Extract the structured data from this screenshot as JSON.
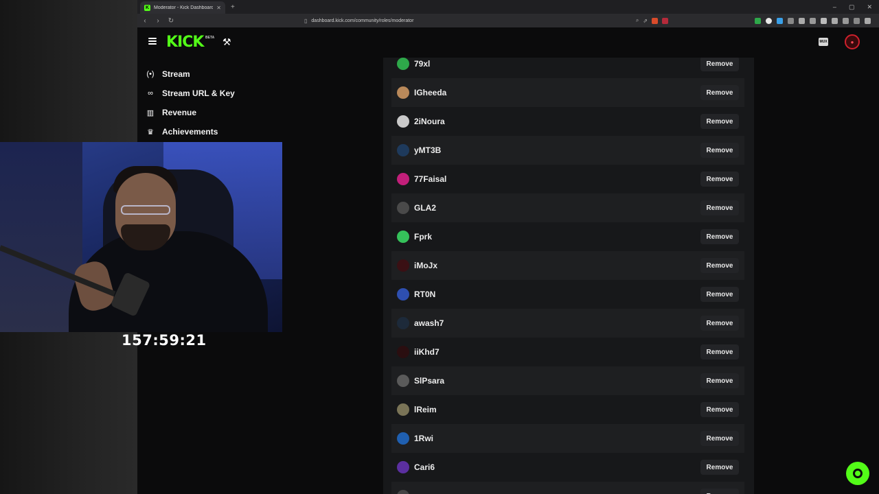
{
  "browser": {
    "tab_title": "Moderator - Kick Dashboard",
    "url": "dashboard.kick.com/community/roles/moderator"
  },
  "header": {
    "logo": "KICK",
    "beta": "BETA",
    "mux_label": "MUX"
  },
  "sidebar": {
    "items": [
      {
        "label": "Stream",
        "icon": "broadcast-icon"
      },
      {
        "label": "Stream URL & Key",
        "icon": "link-icon"
      },
      {
        "label": "Revenue",
        "icon": "chart-icon"
      },
      {
        "label": "Achievements",
        "icon": "trophy-icon"
      }
    ]
  },
  "moderators": {
    "remove_label": "Remove",
    "rows": [
      {
        "name": "79xl",
        "avatar_color": "#2ea84a"
      },
      {
        "name": "IGheeda",
        "avatar_color": "#b9895a"
      },
      {
        "name": "2iNoura",
        "avatar_color": "#c9c9c9"
      },
      {
        "name": "yMT3B",
        "avatar_color": "#1e3a5c"
      },
      {
        "name": "77Faisal",
        "avatar_color": "#c21f7a"
      },
      {
        "name": "GLA2",
        "avatar_color": "#4a4a4a"
      },
      {
        "name": "Fprk",
        "avatar_color": "#35c15a"
      },
      {
        "name": "iMoJx",
        "avatar_color": "#3a1014"
      },
      {
        "name": "RT0N",
        "avatar_color": "#2e4fb0"
      },
      {
        "name": "awash7",
        "avatar_color": "#1d2a3a"
      },
      {
        "name": "iiKhd7",
        "avatar_color": "#2a0e10"
      },
      {
        "name": "SlPsara",
        "avatar_color": "#5a5a5a"
      },
      {
        "name": "lReim",
        "avatar_color": "#7a7457"
      },
      {
        "name": "1Rwi",
        "avatar_color": "#1f5fb0"
      },
      {
        "name": "Cari6",
        "avatar_color": "#5b2fa0"
      },
      {
        "name": "",
        "avatar_color": "#444444"
      }
    ]
  },
  "overlay": {
    "timer": "157:59:21"
  },
  "colors": {
    "brand": "#53fc18",
    "panel": "#17181a",
    "background": "#0b0b0c"
  }
}
